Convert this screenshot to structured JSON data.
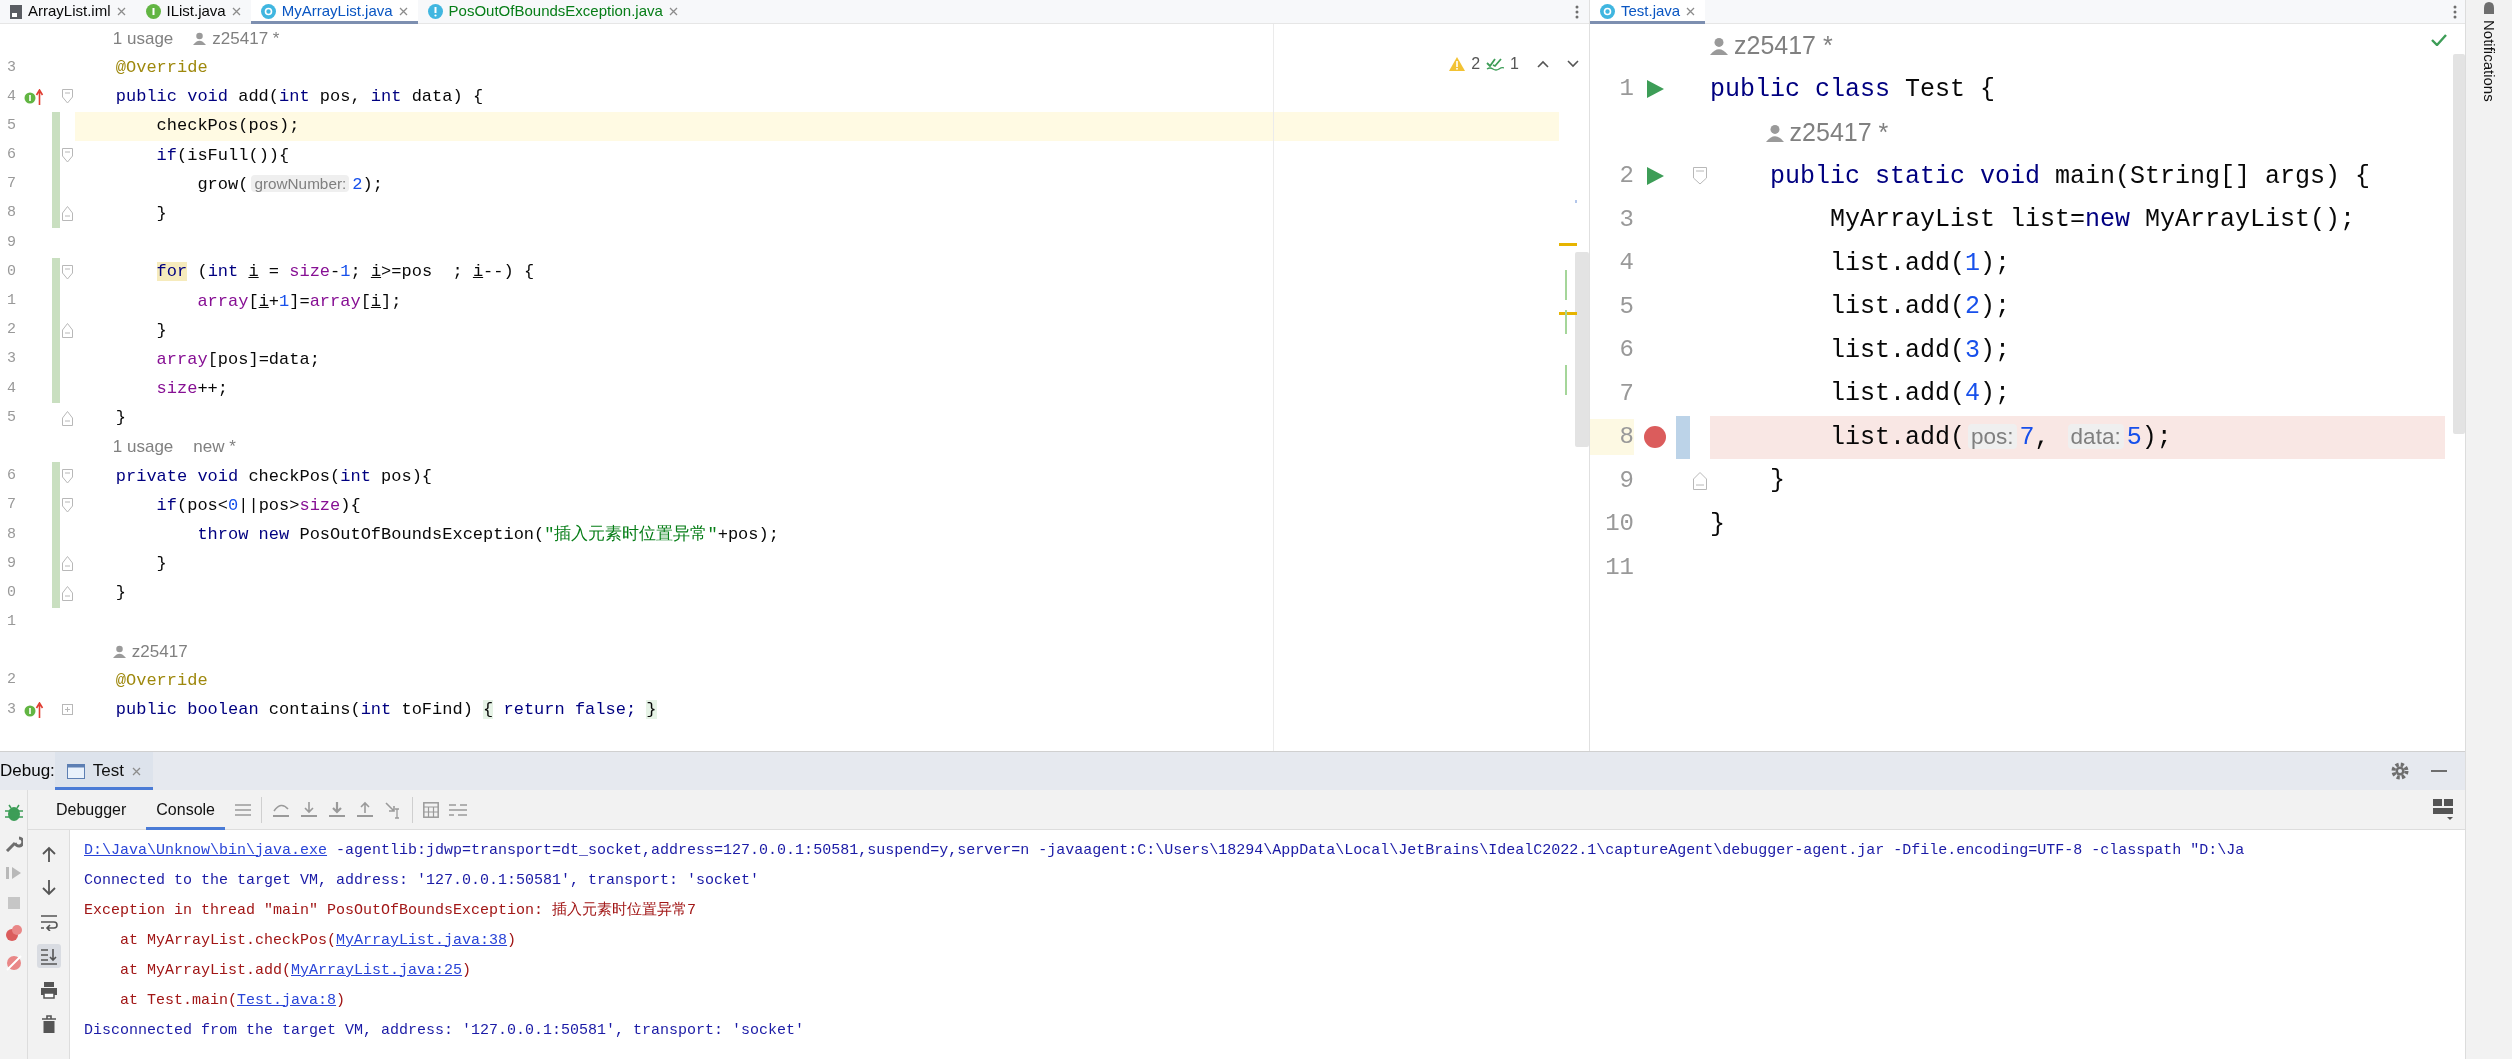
{
  "left_editor": {
    "tabs": [
      {
        "label": "ArrayList.iml",
        "kind": "module",
        "color": "#080808",
        "selected": false
      },
      {
        "label": "IList.java",
        "kind": "interface",
        "color": "#080808",
        "selected": false
      },
      {
        "label": "MyArrayList.java",
        "kind": "class",
        "color": "#0a56c2",
        "selected": true
      },
      {
        "label": "PosOutOfBoundsException.java",
        "kind": "exception",
        "color": "#067d17",
        "selected": false
      }
    ],
    "inspections": {
      "warnings": "2",
      "weak_warnings": "1"
    },
    "lines": [
      {
        "kind": "hint",
        "tokens": [
          {
            "text": "    1 usage",
            "kind": "usage"
          },
          {
            "text": "z25417 *",
            "kind": "author"
          }
        ]
      },
      {
        "kind": "code",
        "number": "3",
        "changed": false,
        "tokens": [
          {
            "text": "    @Override",
            "kind": "ann"
          }
        ]
      },
      {
        "kind": "code",
        "number": "4",
        "changed": false,
        "marker": {
          "kind": "override"
        },
        "fold": {
          "kind": "start"
        },
        "tokens": [
          {
            "text": "    public void ",
            "kind": "kw"
          },
          {
            "text": "add(",
            "kind": "plain"
          },
          {
            "text": "int ",
            "kind": "kw"
          },
          {
            "text": "pos, ",
            "kind": "plain"
          },
          {
            "text": "int ",
            "kind": "kw"
          },
          {
            "text": "data) {",
            "kind": "plain"
          }
        ]
      },
      {
        "kind": "code",
        "number": "5",
        "changed": true,
        "highlight": {
          "kind": "caret"
        },
        "tokens": [
          {
            "text": "        checkPos(pos);",
            "kind": "plain"
          }
        ]
      },
      {
        "kind": "code",
        "number": "6",
        "changed": true,
        "fold": {
          "kind": "start"
        },
        "tokens": [
          {
            "text": "        if",
            "kind": "kw"
          },
          {
            "text": "(isFull()){",
            "kind": "plain"
          }
        ]
      },
      {
        "kind": "code",
        "number": "7",
        "changed": true,
        "tokens": [
          {
            "text": "            grow(",
            "kind": "plain"
          },
          {
            "text": "growNumber:",
            "kind": "param"
          },
          {
            "text": "2",
            "kind": "num"
          },
          {
            "text": ");",
            "kind": "plain"
          }
        ]
      },
      {
        "kind": "code",
        "number": "8",
        "changed": true,
        "fold": {
          "kind": "end"
        },
        "tokens": [
          {
            "text": "        }",
            "kind": "plain"
          }
        ]
      },
      {
        "kind": "code",
        "number": "9",
        "changed": false
      },
      {
        "kind": "code",
        "number": "0",
        "changed": true,
        "fold": {
          "kind": "start"
        },
        "tokens": [
          {
            "text": "        for",
            "kind": "match"
          },
          {
            "text": " (",
            "kind": "plain"
          },
          {
            "text": "int ",
            "kind": "kw"
          },
          {
            "text": "i",
            "kind": "reassigned"
          },
          {
            "text": " = ",
            "kind": "plain"
          },
          {
            "text": "size",
            "kind": "field"
          },
          {
            "text": "-",
            "kind": "plain"
          },
          {
            "text": "1",
            "kind": "num"
          },
          {
            "text": "; ",
            "kind": "plain"
          },
          {
            "text": "i",
            "kind": "reassigned"
          },
          {
            "text": ">=pos  ; ",
            "kind": "plain"
          },
          {
            "text": "i",
            "kind": "reassigned"
          },
          {
            "text": "--) {",
            "kind": "plain"
          }
        ]
      },
      {
        "kind": "code",
        "number": "1",
        "changed": true,
        "tokens": [
          {
            "text": "            array",
            "kind": "field"
          },
          {
            "text": "[",
            "kind": "plain"
          },
          {
            "text": "i",
            "kind": "reassigned"
          },
          {
            "text": "+",
            "kind": "plain"
          },
          {
            "text": "1",
            "kind": "num"
          },
          {
            "text": "]=",
            "kind": "plain"
          },
          {
            "text": "array",
            "kind": "field"
          },
          {
            "text": "[",
            "kind": "plain"
          },
          {
            "text": "i",
            "kind": "reassigned"
          },
          {
            "text": "];",
            "kind": "plain"
          }
        ]
      },
      {
        "kind": "code",
        "number": "2",
        "changed": true,
        "fold": {
          "kind": "end"
        },
        "tokens": [
          {
            "text": "        }",
            "kind": "plain"
          }
        ]
      },
      {
        "kind": "code",
        "number": "3",
        "changed": true,
        "tokens": [
          {
            "text": "        array",
            "kind": "field"
          },
          {
            "text": "[pos]=data;",
            "kind": "plain"
          }
        ]
      },
      {
        "kind": "code",
        "number": "4",
        "changed": true,
        "tokens": [
          {
            "text": "        size",
            "kind": "field"
          },
          {
            "text": "++;",
            "kind": "plain"
          }
        ]
      },
      {
        "kind": "code",
        "number": "5",
        "changed": false,
        "fold": {
          "kind": "end"
        },
        "tokens": [
          {
            "text": "    }",
            "kind": "plain"
          }
        ]
      },
      {
        "kind": "hint",
        "tokens": [
          {
            "text": "    1 usage",
            "kind": "usage"
          },
          {
            "text": "new *",
            "kind": "usage"
          }
        ]
      },
      {
        "kind": "code",
        "number": "6",
        "changed": true,
        "fold": {
          "kind": "start"
        },
        "tokens": [
          {
            "text": "    private void ",
            "kind": "kw"
          },
          {
            "text": "checkPos(",
            "kind": "plain"
          },
          {
            "text": "int ",
            "kind": "kw"
          },
          {
            "text": "pos){",
            "kind": "plain"
          }
        ]
      },
      {
        "kind": "code",
        "number": "7",
        "changed": true,
        "fold": {
          "kind": "start"
        },
        "tokens": [
          {
            "text": "        if",
            "kind": "kw"
          },
          {
            "text": "(pos<",
            "kind": "plain"
          },
          {
            "text": "0",
            "kind": "num"
          },
          {
            "text": "||pos>",
            "kind": "plain"
          },
          {
            "text": "size",
            "kind": "field"
          },
          {
            "text": "){",
            "kind": "plain"
          }
        ]
      },
      {
        "kind": "code",
        "number": "8",
        "changed": true,
        "tokens": [
          {
            "text": "            throw new ",
            "kind": "kw"
          },
          {
            "text": "PosOutOfBoundsException(",
            "kind": "plain"
          },
          {
            "text": "\"插入元素时位置异常\"",
            "kind": "str"
          },
          {
            "text": "+pos);",
            "kind": "plain"
          }
        ]
      },
      {
        "kind": "code",
        "number": "9",
        "changed": true,
        "fold": {
          "kind": "end"
        },
        "tokens": [
          {
            "text": "        }",
            "kind": "plain"
          }
        ]
      },
      {
        "kind": "code",
        "number": "0",
        "changed": true,
        "fold": {
          "kind": "end"
        },
        "tokens": [
          {
            "text": "    }",
            "kind": "plain"
          }
        ]
      },
      {
        "kind": "code",
        "number": "1",
        "changed": false
      },
      {
        "kind": "hint",
        "tokens": [
          {
            "text": "    z25417",
            "kind": "author"
          }
        ]
      },
      {
        "kind": "code",
        "number": "2",
        "changed": false,
        "tokens": [
          {
            "text": "    @Override",
            "kind": "ann"
          }
        ]
      },
      {
        "kind": "code",
        "number": "3",
        "changed": false,
        "marker": {
          "kind": "override"
        },
        "fold": {
          "kind": "collapsed"
        },
        "tokens": [
          {
            "text": "    public boolean ",
            "kind": "kw"
          },
          {
            "text": "contains(",
            "kind": "plain"
          },
          {
            "text": "int ",
            "kind": "kw"
          },
          {
            "text": "toFind) ",
            "kind": "plain"
          },
          {
            "text": "{",
            "kind": "folded"
          },
          {
            "text": " return false; ",
            "kind": "kw"
          },
          {
            "text": "}",
            "kind": "folded"
          }
        ]
      }
    ]
  },
  "right_editor": {
    "tabs": [
      {
        "label": "Test.java",
        "kind": "class",
        "color": "#0a56c2",
        "selected": true
      }
    ],
    "lines": [
      {
        "kind": "hint",
        "tokens": [
          {
            "text": "z25417 *",
            "kind": "author"
          }
        ]
      },
      {
        "kind": "code",
        "number": "1",
        "marker": {
          "kind": "run"
        },
        "tokens": [
          {
            "text": "public class ",
            "kind": "kw"
          },
          {
            "text": "Test {",
            "kind": "plain"
          }
        ]
      },
      {
        "kind": "hint",
        "tokens": [
          {
            "text": "    z25417 *",
            "kind": "author"
          }
        ]
      },
      {
        "kind": "code",
        "number": "2",
        "marker": {
          "kind": "run"
        },
        "fold": {
          "kind": "start"
        },
        "tokens": [
          {
            "text": "    public static void ",
            "kind": "kw"
          },
          {
            "text": "main(String[] args) {",
            "kind": "plain"
          }
        ]
      },
      {
        "kind": "code",
        "number": "3",
        "tokens": [
          {
            "text": "        MyArrayList list=",
            "kind": "plain"
          },
          {
            "text": "new ",
            "kind": "kw"
          },
          {
            "text": "MyArrayList();",
            "kind": "plain"
          }
        ]
      },
      {
        "kind": "code",
        "number": "4",
        "tokens": [
          {
            "text": "        list.add(",
            "kind": "plain"
          },
          {
            "text": "1",
            "kind": "num"
          },
          {
            "text": ");",
            "kind": "plain"
          }
        ]
      },
      {
        "kind": "code",
        "number": "5",
        "tokens": [
          {
            "text": "        list.add(",
            "kind": "plain"
          },
          {
            "text": "2",
            "kind": "num"
          },
          {
            "text": ");",
            "kind": "plain"
          }
        ]
      },
      {
        "kind": "code",
        "number": "6",
        "tokens": [
          {
            "text": "        list.add(",
            "kind": "plain"
          },
          {
            "text": "3",
            "kind": "num"
          },
          {
            "text": ");",
            "kind": "plain"
          }
        ]
      },
      {
        "kind": "code",
        "number": "7",
        "tokens": [
          {
            "text": "        list.add(",
            "kind": "plain"
          },
          {
            "text": "4",
            "kind": "num"
          },
          {
            "text": ");",
            "kind": "plain"
          }
        ]
      },
      {
        "kind": "code",
        "number": "8",
        "marker": {
          "kind": "breakpoint"
        },
        "highlight": {
          "kind": "breakpoint"
        },
        "tokens": [
          {
            "text": "        list.add(",
            "kind": "plain"
          },
          {
            "text": "pos:",
            "kind": "param"
          },
          {
            "text": "7",
            "kind": "num"
          },
          {
            "text": ", ",
            "kind": "plain"
          },
          {
            "text": "data:",
            "kind": "param"
          },
          {
            "text": "5",
            "kind": "num"
          },
          {
            "text": ");",
            "kind": "plain"
          }
        ]
      },
      {
        "kind": "code",
        "number": "9",
        "fold": {
          "kind": "end"
        },
        "tokens": [
          {
            "text": "    }",
            "kind": "plain"
          }
        ]
      },
      {
        "kind": "code",
        "number": "10",
        "tokens": [
          {
            "text": "}",
            "kind": "plain"
          }
        ]
      },
      {
        "kind": "code",
        "number": "11"
      }
    ]
  },
  "notifications": {
    "label": "Notifications"
  },
  "debug": {
    "title": "Debug:",
    "tabs": [
      {
        "label": "Test",
        "selected": true
      }
    ],
    "views": [
      {
        "label": "Debugger",
        "selected": false
      },
      {
        "label": "Console",
        "selected": true
      }
    ],
    "console": [
      {
        "tokens": [
          {
            "text": "D:\\Java\\Unknow\\bin\\java.exe",
            "kind": "link"
          },
          {
            "text": " -agentlib:jdwp=transport=dt_socket,address=127.0.0.1:50581,suspend=y,server=n -javaagent:C:\\Users\\18294\\AppData\\Local\\JetBrains\\IdealC2022.1\\captureAgent\\debugger-agent.jar -Dfile.encoding=UTF-8 -classpath \"D:\\Ja",
            "kind": "info"
          }
        ]
      },
      {
        "tokens": [
          {
            "text": "Connected to the target VM, address: '127.0.0.1:50581', transport: 'socket'",
            "kind": "info"
          }
        ]
      },
      {
        "tokens": [
          {
            "text": "Exception in thread \"main\" PosOutOfBoundsException: 插入元素时位置异常7",
            "kind": "error"
          }
        ]
      },
      {
        "tokens": [
          {
            "text": "    at MyArrayList.checkPos(",
            "kind": "error"
          },
          {
            "text": "MyArrayList.java:38",
            "kind": "link"
          },
          {
            "text": ")",
            "kind": "error"
          }
        ]
      },
      {
        "tokens": [
          {
            "text": "    at MyArrayList.add(",
            "kind": "error"
          },
          {
            "text": "MyArrayList.java:25",
            "kind": "link"
          },
          {
            "text": ")",
            "kind": "error"
          }
        ]
      },
      {
        "tokens": [
          {
            "text": "    at Test.main(",
            "kind": "error"
          },
          {
            "text": "Test.java:8",
            "kind": "link"
          },
          {
            "text": ")",
            "kind": "error"
          }
        ]
      },
      {
        "tokens": [
          {
            "text": "Disconnected from the target VM, address: '127.0.0.1:50581', transport: 'socket'",
            "kind": "info"
          }
        ]
      }
    ]
  }
}
